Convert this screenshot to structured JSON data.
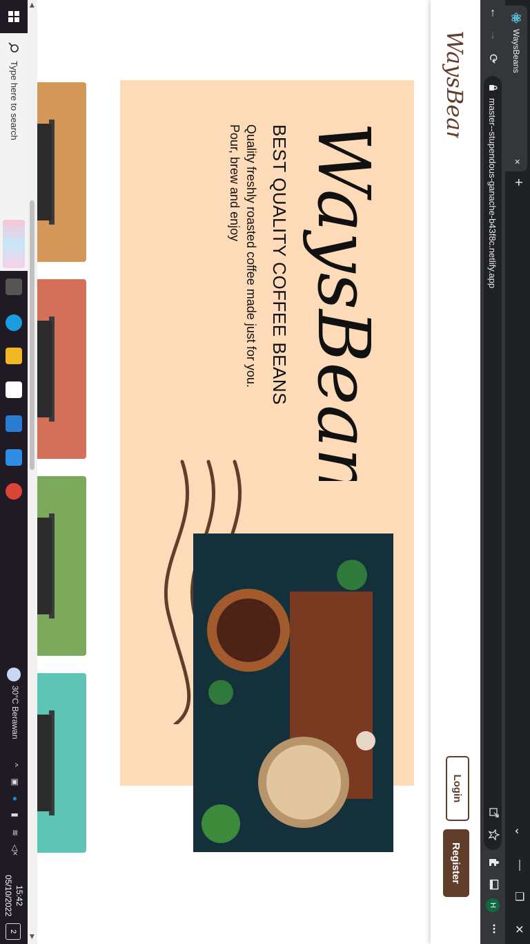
{
  "browser": {
    "tab_title": "WaysBeans",
    "tab_close": "×",
    "new_tab": "+",
    "url": "master--stupendous-ganache-b43f8c.netlify.app",
    "profile_initial": "H",
    "window_controls": {
      "minimize": "—",
      "restore": "❐",
      "close": "✕",
      "menu": "⌄"
    },
    "nav": {
      "back": "↑",
      "forward": "↓",
      "reload": "⟳"
    },
    "toolbar_icons": [
      "share-icon",
      "star-icon",
      "extensions-icon",
      "sidebar-icon",
      "menu-icon"
    ]
  },
  "site": {
    "brand": "WaysBeans",
    "login_label": "Login",
    "register_label": "Register"
  },
  "hero": {
    "tagline": "BEST QUALITY COFFEE BEANS",
    "desc_line1": "Quality freshly roasted coffee made just for you.",
    "desc_line2": "Pour, brew and enjoy"
  },
  "cards": [
    {
      "color": "#d4975a"
    },
    {
      "color": "#d4705a"
    },
    {
      "color": "#7da95d"
    },
    {
      "color": "#5ec5b5"
    }
  ],
  "taskbar": {
    "search_placeholder": "Type here to search",
    "weather": "30°C  Berawan",
    "time": "15:42",
    "date": "05/10/2022",
    "notification_count": "2"
  },
  "colors": {
    "brand_brown": "#613d2b",
    "hero_bg": "#fddab8"
  }
}
